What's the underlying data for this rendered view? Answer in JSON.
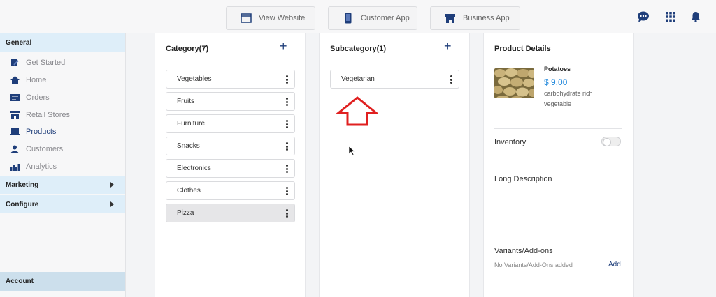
{
  "header": {
    "buttons": [
      {
        "label": "View Website",
        "icon": "browser-window-icon"
      },
      {
        "label": "Customer App",
        "icon": "mobile-phone-icon"
      },
      {
        "label": "Business App",
        "icon": "storefront-icon"
      }
    ],
    "right_icons": [
      "support-chat-icon",
      "app-grid-icon",
      "notification-bell-icon"
    ]
  },
  "sidebar": {
    "general_label": "General",
    "items": [
      {
        "label": "Get Started",
        "icon": "edit-doc-icon"
      },
      {
        "label": "Home",
        "icon": "home-icon"
      },
      {
        "label": "Orders",
        "icon": "orders-icon"
      },
      {
        "label": "Retail Stores",
        "icon": "store-icon"
      },
      {
        "label": "Products",
        "icon": "products-icon",
        "active": true
      },
      {
        "label": "Customers",
        "icon": "customers-icon"
      },
      {
        "label": "Analytics",
        "icon": "analytics-icon"
      }
    ],
    "marketing_label": "Marketing",
    "configure_label": "Configure",
    "account_label": "Account"
  },
  "category": {
    "title": "Category(7)",
    "add_symbol": "+",
    "items": [
      "Vegetables",
      "Fruits",
      "Furniture",
      "Snacks",
      "Electronics",
      "Clothes",
      "Pizza"
    ],
    "selected": "Pizza"
  },
  "subcategory": {
    "title": "Subcategory(1)",
    "add_symbol": "+",
    "items": [
      "Vegetarian"
    ]
  },
  "details": {
    "title": "Product Details",
    "product_name": "Potatoes",
    "price": "$ 9.00",
    "description": "carbohydrate rich vegetable",
    "inventory_label": "Inventory",
    "inventory_enabled": false,
    "long_description_label": "Long Description",
    "variants_label": "Variants/Add-ons",
    "no_variants_text": "No Variants/Add-Ons added",
    "add_label": "Add"
  },
  "colors": {
    "accent_blue": "#1f3e7a",
    "price_blue": "#2a8ddd",
    "section_highlight": "#deeef9",
    "annotation_arrow": "#e02020"
  }
}
